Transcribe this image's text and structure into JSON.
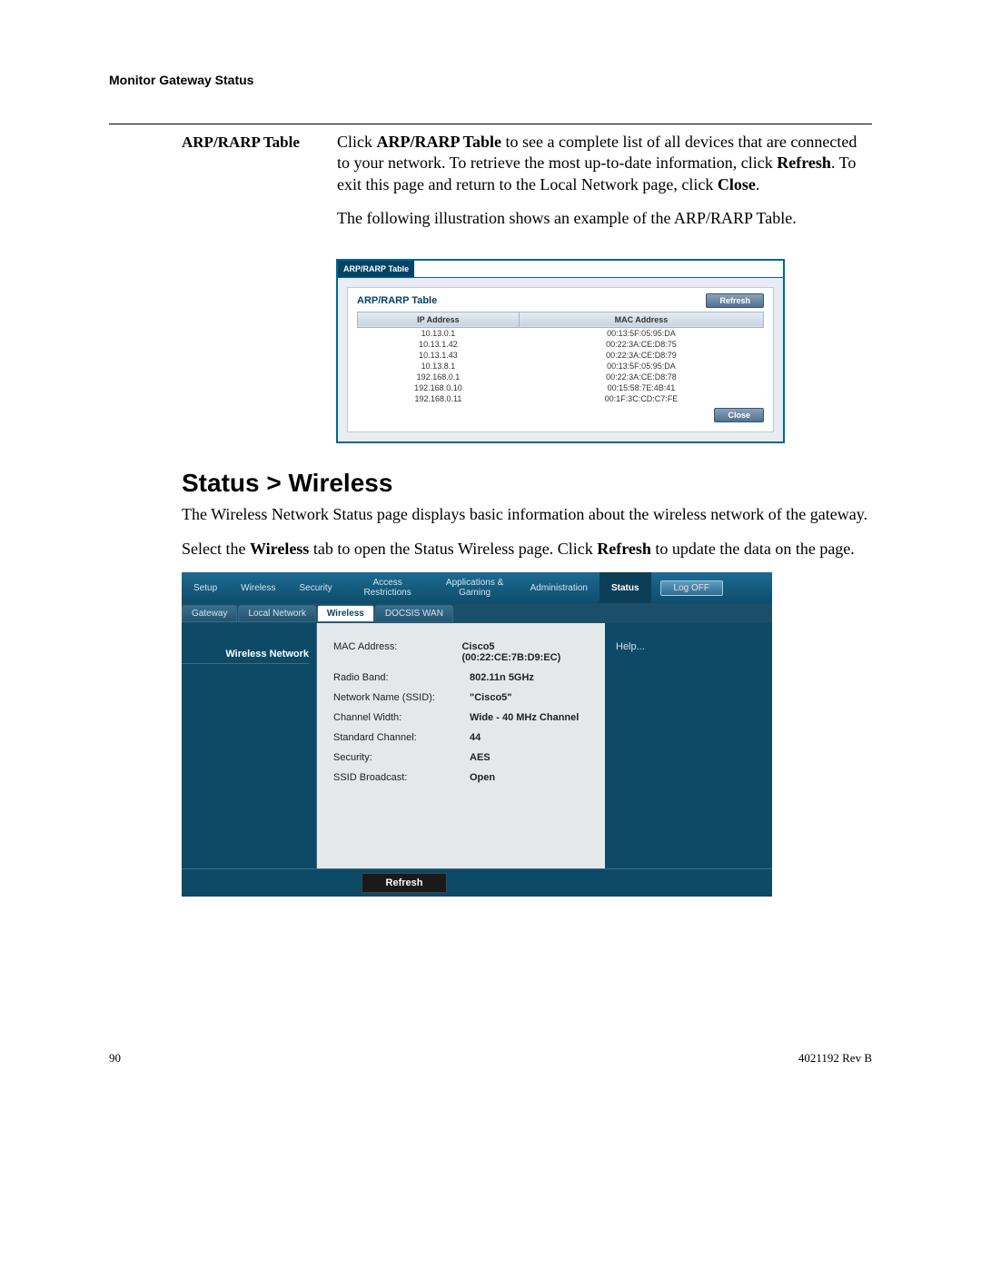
{
  "chapter_header": "Monitor Gateway Status",
  "section1": {
    "label": "ARP/RARP Table",
    "para1_prefix": "Click ",
    "para1_bold1": "ARP/RARP Table",
    "para1_mid1": " to see a complete list of all devices that are connected to your network. To retrieve the most up-to-date information, click ",
    "para1_bold2": "Refresh",
    "para1_mid2": ". To exit this page and return to the Local Network page, click ",
    "para1_bold3": "Close",
    "para1_suffix": ".",
    "para2": "The following illustration shows an example of the ARP/RARP Table."
  },
  "arp": {
    "tab": "ARP/RARP Table",
    "title": "ARP/RARP Table",
    "refresh": "Refresh",
    "close": "Close",
    "col_ip": "IP Address",
    "col_mac": "MAC Address",
    "rows": [
      {
        "ip": "10.13.0.1",
        "mac": "00:13:5F:05:95:DA"
      },
      {
        "ip": "10.13.1.42",
        "mac": "00:22:3A:CE:D8:75"
      },
      {
        "ip": "10.13.1.43",
        "mac": "00:22:3A:CE:D8:79"
      },
      {
        "ip": "10.13.8.1",
        "mac": "00:13:5F:05:95:DA"
      },
      {
        "ip": "192.168.0.1",
        "mac": "00:22:3A:CE:D8:78"
      },
      {
        "ip": "192.168.0.10",
        "mac": "00:15:58:7E:4B:41"
      },
      {
        "ip": "192.168.0.11",
        "mac": "00:1F:3C:CD:C7:FE"
      }
    ]
  },
  "heading2": "Status > Wireless",
  "body2_p1": "The Wireless Network Status page displays basic information about the wireless network of the gateway.",
  "body2_p2_prefix": "Select the ",
  "body2_p2_bold1": "Wireless",
  "body2_p2_mid": " tab to open the Status Wireless page. Click ",
  "body2_p2_bold2": "Refresh",
  "body2_p2_suffix": " to update the data on the page.",
  "nav1": {
    "setup": "Setup",
    "wireless": "Wireless",
    "security": "Security",
    "access": "Access Restrictions",
    "apps": "Applications & Gaming",
    "admin": "Administration",
    "status": "Status",
    "logoff": "Log OFF"
  },
  "nav2": {
    "gateway": "Gateway",
    "local": "Local Network",
    "wireless": "Wireless",
    "docsis": "DOCSIS WAN"
  },
  "wifi": {
    "section_label": "Wireless Network",
    "help": "Help...",
    "rows": [
      {
        "k": "MAC Address:",
        "v": "Cisco5 (00:22:CE:7B:D9:EC)"
      },
      {
        "k": "Radio Band:",
        "v": "802.11n 5GHz"
      },
      {
        "k": "Network Name (SSID):",
        "v": "\"Cisco5\""
      },
      {
        "k": "Channel Width:",
        "v": "Wide - 40 MHz Channel"
      },
      {
        "k": "Standard Channel:",
        "v": "44"
      },
      {
        "k": "Security:",
        "v": "AES"
      },
      {
        "k": "SSID Broadcast:",
        "v": "Open"
      }
    ],
    "refresh": "Refresh"
  },
  "footer": {
    "page": "90",
    "docid": "4021192 Rev B"
  }
}
